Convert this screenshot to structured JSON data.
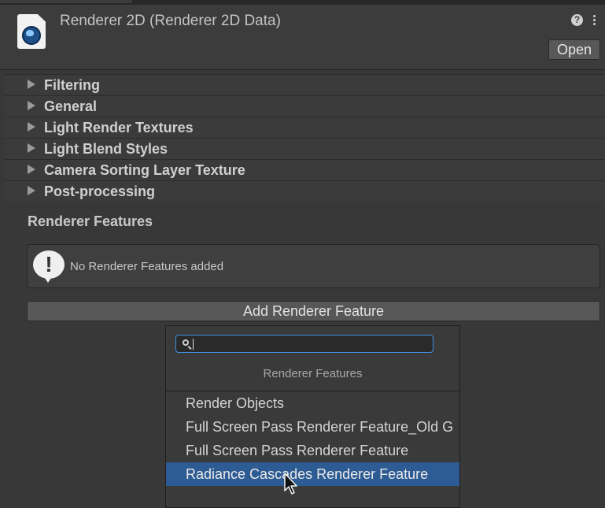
{
  "header": {
    "title": "Renderer 2D (Renderer 2D Data)",
    "open_label": "Open",
    "help_glyph": "?",
    "icons": [
      "renderer-asset-icon",
      "help-icon",
      "kebab-menu-icon"
    ]
  },
  "foldouts": [
    {
      "label": "Filtering"
    },
    {
      "label": "General"
    },
    {
      "label": "Light Render Textures"
    },
    {
      "label": "Light Blend Styles"
    },
    {
      "label": "Camera Sorting Layer Texture"
    },
    {
      "label": "Post-processing"
    }
  ],
  "renderer_features": {
    "title": "Renderer Features",
    "warning_glyph": "!",
    "empty_message": "No Renderer Features added",
    "add_button_label": "Add Renderer Feature"
  },
  "dropdown": {
    "search_value": "",
    "header": "Renderer Features",
    "items": [
      {
        "label": "Render Objects"
      },
      {
        "label": "Full Screen Pass Renderer Feature_Old G"
      },
      {
        "label": "Full Screen Pass Renderer Feature"
      },
      {
        "label": "Radiance Cascades Renderer Feature"
      }
    ],
    "selected_index": 3
  },
  "colors": {
    "background": "#383838",
    "selection": "#2d5b93",
    "search_focus": "#3f8fe0"
  }
}
